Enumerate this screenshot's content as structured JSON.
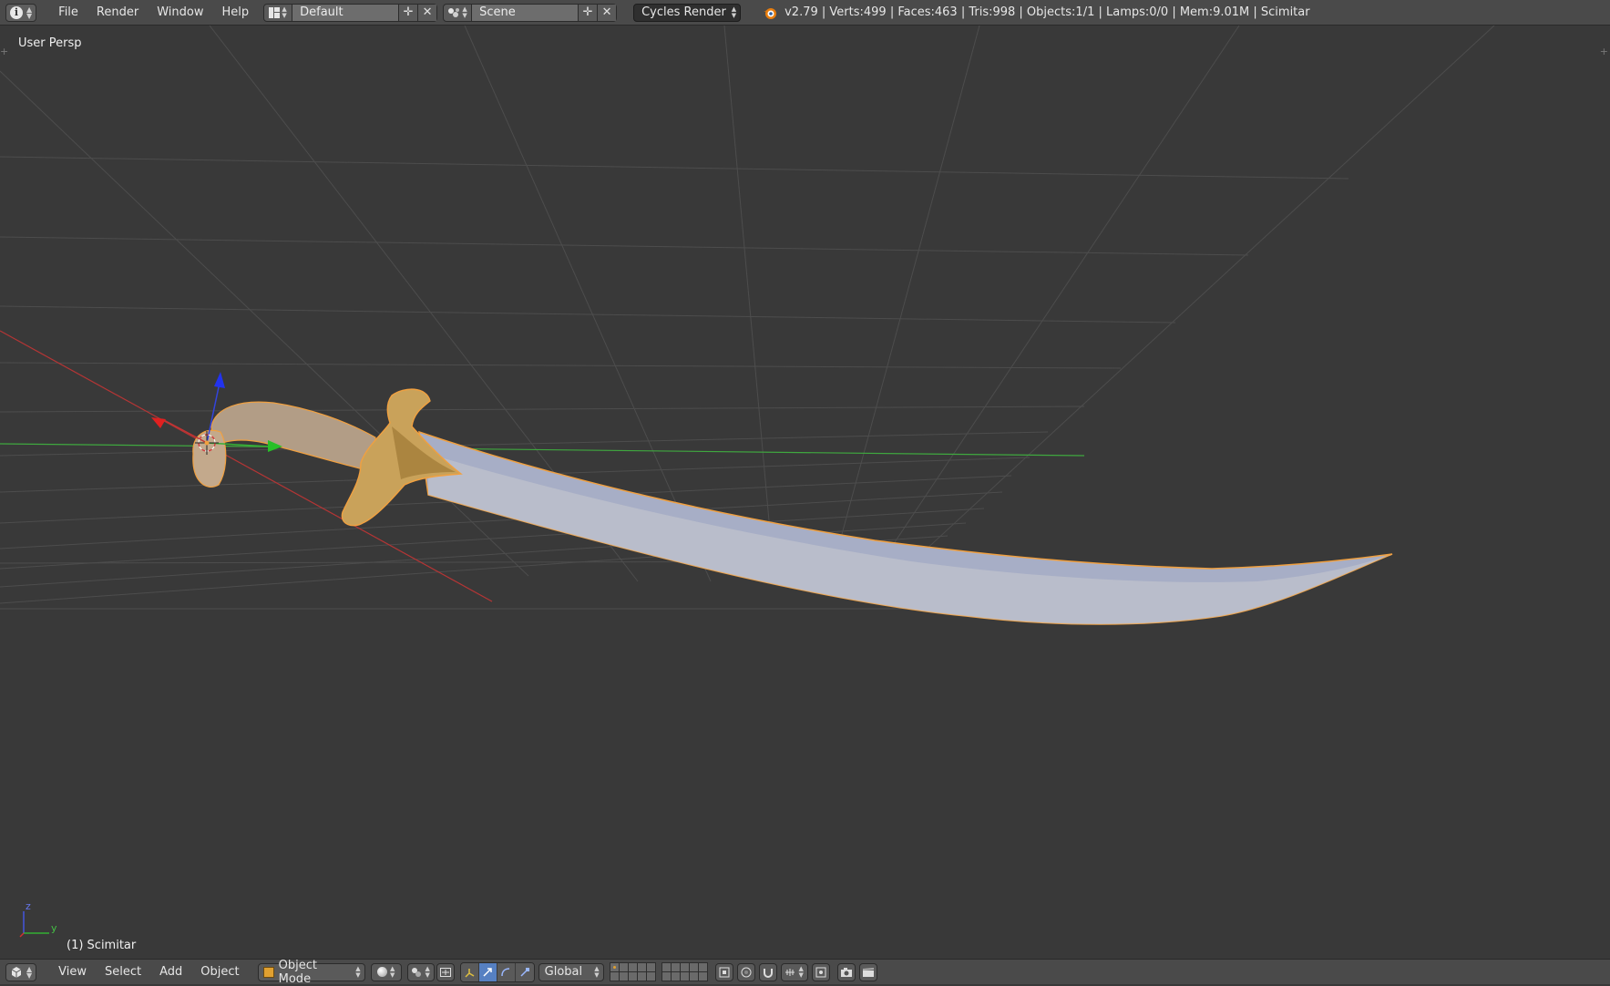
{
  "top_header": {
    "editor_type_icon": "info-icon",
    "menus": [
      "File",
      "Render",
      "Window",
      "Help"
    ],
    "screen_layout": {
      "icon": "screen-layout-icon",
      "value": "Default"
    },
    "scene": {
      "icon": "scene-icon",
      "value": "Scene"
    },
    "render_engine": "Cycles Render",
    "stats": "v2.79 | Verts:499 | Faces:463 | Tris:998 | Objects:1/1 | Lamps:0/0 | Mem:9.01M | Scimitar"
  },
  "viewport": {
    "view_label": "User Persp",
    "object_label": "(1) Scimitar",
    "axis_labels": {
      "z": "z",
      "y": "y"
    },
    "colors": {
      "background": "#393939",
      "grid": "#4a4a4a",
      "x_axis": "#c23a3a",
      "y_axis": "#3fa83f",
      "selection_outline": "#f0a040",
      "blade": "#a6adc4",
      "guard": "#c9a25a",
      "grip": "#b09a84"
    }
  },
  "bottom_header": {
    "editor_type_icon": "3d-view-icon",
    "menus": [
      "View",
      "Select",
      "Add",
      "Object"
    ],
    "mode": "Object Mode",
    "viewport_shading_icon": "solid-sphere-icon",
    "pivot_icon": "pivot-point-icon",
    "transform_orientation": "Global"
  }
}
